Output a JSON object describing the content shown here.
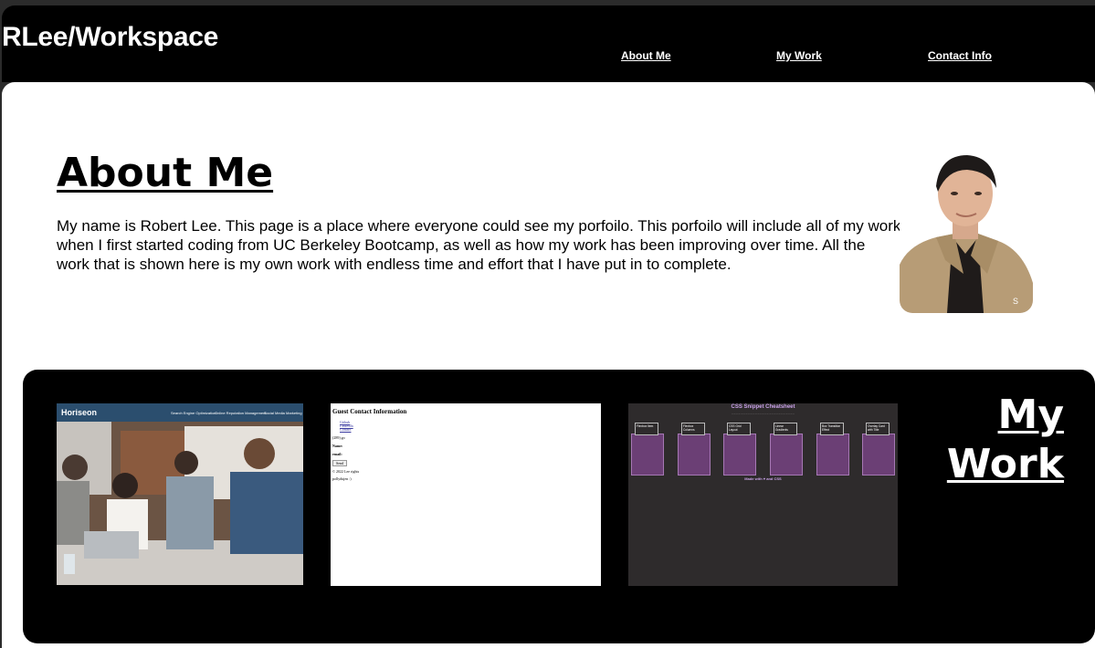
{
  "header": {
    "brand": "RLee/Workspace",
    "nav": [
      {
        "label": "About Me"
      },
      {
        "label": "My Work"
      },
      {
        "label": "Contact Info"
      }
    ]
  },
  "about": {
    "title": "About Me",
    "text": "My name is Robert Lee. This page is a place where everyone could see my porfoilo. This porfoilo will include all of my work when I first started coding from UC Berkeley Bootcamp, as well as how my work has been improving over time. All the work that is shown here is my own work with endless time and effort that I have put in to complete.",
    "photo_icon": "profile-photo"
  },
  "work": {
    "title": "My Work",
    "projects": [
      {
        "logo": "Horiseon",
        "nav": [
          "Search Engine Optimization",
          "Online Reputation Management",
          "Social Media Marketing"
        ]
      },
      {
        "heading": "Guest Contact Information",
        "links": [
          "Github",
          "LinkedIn",
          "Contact"
        ],
        "lines": [
          "(289) go",
          "Name:",
          "email:",
          "Send",
          "© 2022 Lee rights",
          "pollydujen :)"
        ]
      },
      {
        "title": "CSS Snippet Cheatsheet",
        "cards": [
          "Flexbox Item",
          "Flexbox Columns",
          "CSS Grid Layout",
          "Linear Gradients",
          "Box Transition Effect",
          "Overlay Card with Title"
        ],
        "footer": "Made with ♥ and CSS"
      }
    ]
  },
  "colors": {
    "header_bg": "#000000",
    "page_bg": "#ffffff",
    "accent_purple": "#6b3f75"
  }
}
